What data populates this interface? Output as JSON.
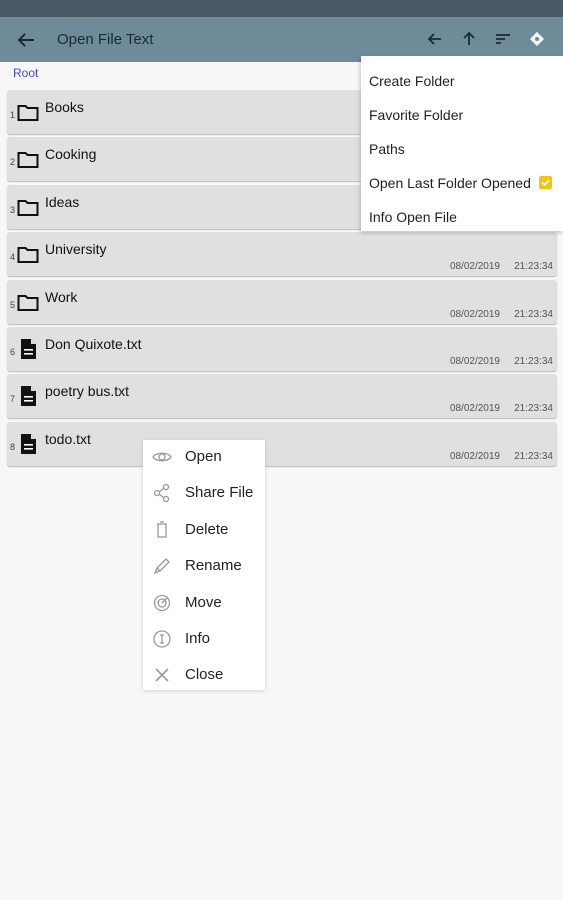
{
  "appbar": {
    "title": "Open File Text",
    "icons": [
      "back-arrow-icon",
      "arrow-left-icon",
      "arrow-up-icon",
      "sort-icon",
      "diamond-icon"
    ]
  },
  "breadcrumb": "Root",
  "items": [
    {
      "num": "1",
      "name": "Books",
      "type": "folder",
      "date": "",
      "time": ""
    },
    {
      "num": "2",
      "name": "Cooking",
      "type": "folder",
      "date": "",
      "time": ""
    },
    {
      "num": "3",
      "name": "Ideas",
      "type": "folder",
      "date": "",
      "time": ""
    },
    {
      "num": "4",
      "name": "University",
      "type": "folder",
      "date": "08/02/2019",
      "time": "21:23:34"
    },
    {
      "num": "5",
      "name": "Work",
      "type": "folder",
      "date": "08/02/2019",
      "time": "21:23:34"
    },
    {
      "num": "6",
      "name": "Don Quixote.txt",
      "type": "file",
      "date": "08/02/2019",
      "time": "21:23:34"
    },
    {
      "num": "7",
      "name": "poetry bus.txt",
      "type": "file",
      "date": "08/02/2019",
      "time": "21:23:34"
    },
    {
      "num": "8",
      "name": "todo.txt",
      "type": "file",
      "date": "08/02/2019",
      "time": "21:23:34"
    }
  ],
  "overflow_menu": [
    {
      "label": "Create Folder"
    },
    {
      "label": "Favorite Folder"
    },
    {
      "label": "Paths"
    },
    {
      "label": "Open Last Folder Opened",
      "checked": true
    },
    {
      "label": "Info Open File"
    }
  ],
  "context_menu": [
    {
      "label": "Open",
      "icon": "eye-icon"
    },
    {
      "label": "Share File",
      "icon": "share-icon"
    },
    {
      "label": "Delete",
      "icon": "trash-icon"
    },
    {
      "label": "Rename",
      "icon": "pencil-icon"
    },
    {
      "label": "Move",
      "icon": "move-icon"
    },
    {
      "label": "Info",
      "icon": "info-icon"
    },
    {
      "label": "Close",
      "icon": "close-icon"
    }
  ],
  "colors": {
    "appbar": "#6e8b9a",
    "statusbar": "#4a5a64",
    "row": "#e0e0e0",
    "breadcrumb": "#3b4fd6",
    "checkbox": "#f3c316"
  }
}
